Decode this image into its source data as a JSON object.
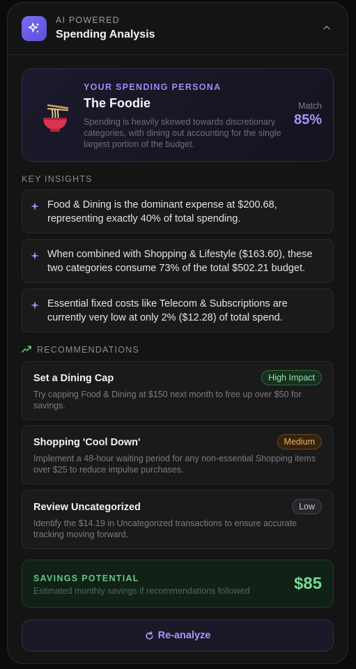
{
  "header": {
    "kicker": "AI POWERED",
    "title": "Spending Analysis"
  },
  "persona": {
    "kicker": "YOUR SPENDING PERSONA",
    "name": "The Foodie",
    "description": "Spending is heavily skewed towards discretionary categories, with dining out accounting for the single largest portion of the budget.",
    "match_label": "Match",
    "match_value": "85%"
  },
  "insights": {
    "label": "KEY INSIGHTS",
    "items": [
      {
        "text": "Food & Dining is the dominant expense at $200.68, representing exactly 40% of total spending."
      },
      {
        "text": "When combined with Shopping & Lifestyle ($163.60), these two categories consume 73% of the total $502.21 budget."
      },
      {
        "text": "Essential fixed costs like Telecom & Subscriptions are currently very low at only 2% ($12.28) of total spend."
      }
    ]
  },
  "recommendations": {
    "label": "RECOMMENDATIONS",
    "items": [
      {
        "title": "Set a Dining Cap",
        "badge": "High Impact",
        "level": "high",
        "description": "Try capping Food & Dining at $150 next month to free up over $50 for savings."
      },
      {
        "title": "Shopping 'Cool Down'",
        "badge": "Medium",
        "level": "medium",
        "description": "Implement a 48-hour waiting period for any non-essential Shopping items over $25 to reduce impulse purchases."
      },
      {
        "title": "Review Uncategorized",
        "badge": "Low",
        "level": "low",
        "description": "Identify the $14.19 in Uncategorized transactions to ensure accurate tracking moving forward."
      }
    ]
  },
  "savings": {
    "kicker": "SAVINGS POTENTIAL",
    "subtitle": "Estimated monthly savings if recommendations followed",
    "value": "$85"
  },
  "actions": {
    "reanalyze_label": "Re-analyze"
  },
  "colors": {
    "accent": "#a595f7",
    "success": "#74d98f",
    "warning": "#f5b25b"
  },
  "icons": {
    "ai": "sparkles-icon",
    "collapse": "chevron-up-icon",
    "persona": "noodle-bowl-icon",
    "insight": "sparkle-icon",
    "recommendations": "trending-up-icon",
    "reanalyze": "refresh-icon"
  }
}
